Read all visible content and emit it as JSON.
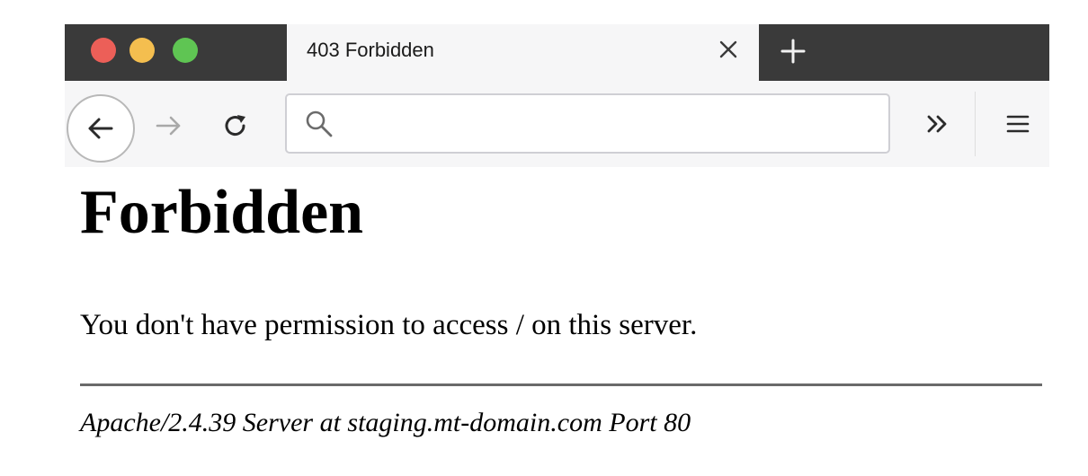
{
  "browser": {
    "window_controls": {
      "close_color": "#ec5f58",
      "minimize_color": "#f4be4f",
      "zoom_color": "#5fc553"
    },
    "tab": {
      "title": "403 Forbidden",
      "close_icon": "close-icon"
    },
    "new_tab_icon": "plus-icon",
    "toolbar": {
      "back_icon": "arrow-left-icon",
      "forward_icon": "arrow-right-icon",
      "reload_icon": "reload-icon",
      "overflow_icon": "double-chevron-right-icon",
      "menu_icon": "hamburger-menu-icon"
    },
    "address_bar": {
      "search_icon": "search-icon",
      "value": ""
    }
  },
  "page": {
    "heading": "Forbidden",
    "message": "You don't have permission to access / on this server.",
    "server_signature": "Apache/2.4.39 Server at staging.mt-domain.com Port 80"
  }
}
